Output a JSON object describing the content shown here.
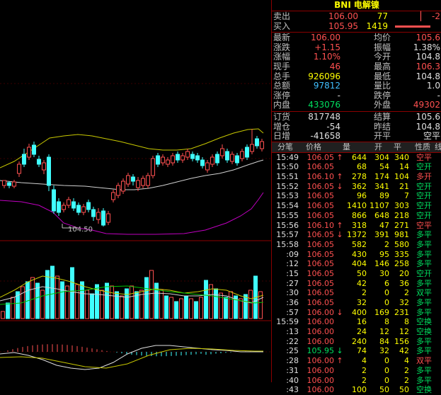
{
  "header": {
    "code": "BNI",
    "name": "电解镍"
  },
  "quote": {
    "ask": {
      "label": "卖出",
      "price": "106.00",
      "vol": "77",
      "chg": "-2"
    },
    "bid": {
      "label": "买入",
      "price": "105.95",
      "vol": "1419"
    },
    "rows": [
      {
        "l1": "最新",
        "v1": "106.00",
        "c1": "red",
        "l2": "均价",
        "v2": "105.6",
        "c2": "red"
      },
      {
        "l1": "涨跌",
        "v1": "+1.15",
        "c1": "red",
        "l2": "振幅",
        "v2": "1.38%",
        "c2": "white"
      },
      {
        "l1": "涨幅",
        "v1": "1.10%",
        "c1": "red",
        "l2": "今开",
        "v2": "104.8",
        "c2": "white"
      },
      {
        "l1": "现手",
        "v1": "46",
        "c1": "red",
        "l2": "最高",
        "v2": "106.3",
        "c2": "red"
      },
      {
        "l1": "总手",
        "v1": "926096",
        "c1": "yellow",
        "l2": "最低",
        "v2": "104.8",
        "c2": "white"
      },
      {
        "l1": "总额",
        "v1": "97812",
        "c1": "cyan",
        "l2": "量比",
        "v2": "1.0",
        "c2": "white"
      },
      {
        "l1": "涨停",
        "v1": "-",
        "c1": "white",
        "l2": "跌停",
        "v2": "-",
        "c2": "white"
      },
      {
        "l1": "内盘",
        "v1": "433076",
        "c1": "green",
        "l2": "外盘",
        "v2": "49302",
        "c2": "red"
      }
    ],
    "rows2": [
      {
        "l1": "订货",
        "v1": "817748",
        "c1": "white",
        "l2": "结算",
        "v2": "105.6",
        "c2": "white"
      },
      {
        "l1": "增仓",
        "v1": "-54",
        "c1": "white",
        "l2": "昨结",
        "v2": "104.8",
        "c2": "white"
      },
      {
        "l1": "日增",
        "v1": "-41658",
        "c1": "white",
        "l2": "开平",
        "v2": "空平",
        "c2": "white"
      }
    ]
  },
  "ticks_header": {
    "time": "分笔",
    "price": "价格",
    "qty": "量",
    "open": "开",
    "close": "平",
    "nature": "性质",
    "extra": "线"
  },
  "ticks": [
    {
      "t": "15:49",
      "p": "106.05",
      "a": "↑",
      "q": "644",
      "o": "304",
      "c": "340",
      "n": "空平",
      "pc": "red",
      "nc": "red"
    },
    {
      "t": "15:50",
      "p": "106.05",
      "a": "",
      "q": "68",
      "o": "54",
      "c": "14",
      "n": "空开",
      "pc": "red",
      "nc": "green"
    },
    {
      "t": "15:51",
      "p": "106.10",
      "a": "↑",
      "q": "278",
      "o": "174",
      "c": "104",
      "n": "多开",
      "pc": "red",
      "nc": "red"
    },
    {
      "t": "15:52",
      "p": "106.05",
      "a": "↓",
      "q": "362",
      "o": "341",
      "c": "21",
      "n": "空开",
      "pc": "red",
      "nc": "green"
    },
    {
      "t": "15:53",
      "p": "106.05",
      "a": "",
      "q": "96",
      "o": "89",
      "c": "7",
      "n": "空开",
      "pc": "red",
      "nc": "green"
    },
    {
      "t": "15:54",
      "p": "106.05",
      "a": "",
      "q": "1410",
      "o": "1107",
      "c": "303",
      "n": "空开",
      "pc": "red",
      "nc": "green"
    },
    {
      "t": "15:55",
      "p": "106.05",
      "a": "",
      "q": "866",
      "o": "648",
      "c": "218",
      "n": "空开",
      "pc": "red",
      "nc": "green"
    },
    {
      "t": "15:56",
      "p": "106.10",
      "a": "↑",
      "q": "318",
      "o": "47",
      "c": "271",
      "n": "空平",
      "pc": "red",
      "nc": "red"
    },
    {
      "t": "15:57",
      "p": "106.05",
      "a": "↓",
      "q": "1372",
      "o": "391",
      "c": "981",
      "n": "多平",
      "pc": "red",
      "nc": "green"
    },
    {
      "t": "15:58",
      "p": "106.05",
      "a": "",
      "q": "582",
      "o": "2",
      "c": "580",
      "n": "多平",
      "pc": "red",
      "nc": "green"
    },
    {
      "t": ":09",
      "p": "106.05",
      "a": "",
      "q": "430",
      "o": "95",
      "c": "335",
      "n": "多平",
      "pc": "red",
      "nc": "green"
    },
    {
      "t": ":12",
      "p": "106.05",
      "a": "",
      "q": "404",
      "o": "146",
      "c": "258",
      "n": "多平",
      "pc": "red",
      "nc": "green"
    },
    {
      "t": ":15",
      "p": "106.05",
      "a": "",
      "q": "50",
      "o": "30",
      "c": "20",
      "n": "空开",
      "pc": "red",
      "nc": "green"
    },
    {
      "t": ":27",
      "p": "106.05",
      "a": "",
      "q": "42",
      "o": "6",
      "c": "36",
      "n": "多平",
      "pc": "red",
      "nc": "green"
    },
    {
      "t": ":30",
      "p": "106.05",
      "a": "",
      "q": "2",
      "o": "0",
      "c": "2",
      "n": "双平",
      "pc": "red",
      "nc": "green"
    },
    {
      "t": ":36",
      "p": "106.05",
      "a": "",
      "q": "32",
      "o": "0",
      "c": "32",
      "n": "多平",
      "pc": "red",
      "nc": "green"
    },
    {
      "t": ":57",
      "p": "106.00",
      "a": "↓",
      "q": "400",
      "o": "169",
      "c": "231",
      "n": "多平",
      "pc": "red",
      "nc": "green"
    },
    {
      "t": "15:59",
      "p": "106.00",
      "a": "",
      "q": "16",
      "o": "8",
      "c": "8",
      "n": "空换",
      "pc": "red",
      "nc": "green"
    },
    {
      "t": ":13",
      "p": "106.00",
      "a": "",
      "q": "24",
      "o": "12",
      "c": "12",
      "n": "空换",
      "pc": "red",
      "nc": "green"
    },
    {
      "t": ":22",
      "p": "106.00",
      "a": "",
      "q": "240",
      "o": "84",
      "c": "156",
      "n": "多平",
      "pc": "red",
      "nc": "green"
    },
    {
      "t": ":25",
      "p": "105.95",
      "a": "↓",
      "q": "74",
      "o": "32",
      "c": "42",
      "n": "多平",
      "pc": "green",
      "nc": "green"
    },
    {
      "t": ":28",
      "p": "106.00",
      "a": "↑",
      "q": "4",
      "o": "0",
      "c": "4",
      "n": "双平",
      "pc": "red",
      "nc": "red"
    },
    {
      "t": ":31",
      "p": "106.00",
      "a": "",
      "q": "2",
      "o": "0",
      "c": "2",
      "n": "多平",
      "pc": "red",
      "nc": "green"
    },
    {
      "t": ":40",
      "p": "106.00",
      "a": "",
      "q": "2",
      "o": "0",
      "c": "2",
      "n": "多平",
      "pc": "red",
      "nc": "green"
    },
    {
      "t": ":43",
      "p": "106.00",
      "a": "",
      "q": "100",
      "o": "50",
      "c": "50",
      "n": "空换",
      "pc": "red",
      "nc": "green"
    }
  ],
  "chart": {
    "low_label": "104.50"
  },
  "colors": {
    "up": "#ff5050",
    "down": "#40ffff",
    "boll": "#c8c800",
    "mid": "#d0d0d0",
    "lower": "#c000c0",
    "grid": "#8b0000"
  }
}
